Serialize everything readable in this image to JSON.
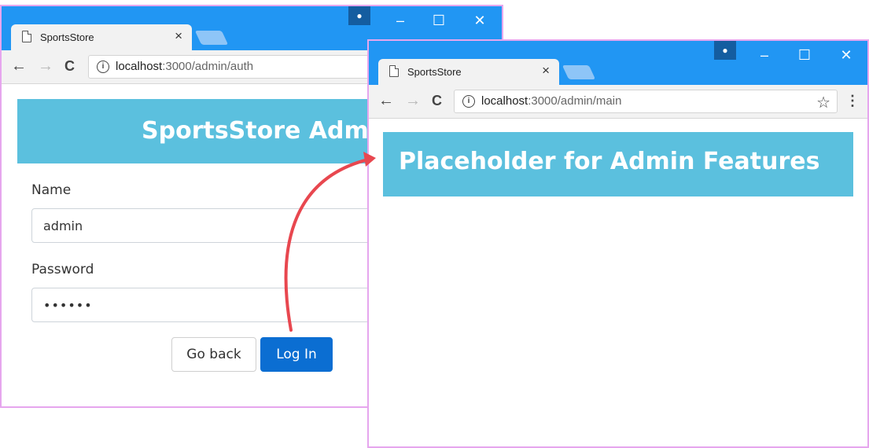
{
  "back_window": {
    "tab_title": "SportsStore",
    "url_host": "localhost",
    "url_path": ":3000/admin/auth",
    "banner_title": "SportsStore Admin",
    "form": {
      "name_label": "Name",
      "name_value": "admin",
      "password_label": "Password",
      "password_value": "••••••"
    },
    "buttons": {
      "go_back": "Go back",
      "log_in": "Log In"
    }
  },
  "front_window": {
    "tab_title": "SportsStore",
    "url_host": "localhost",
    "url_path": ":3000/admin/main",
    "banner_title": "Placeholder for Admin Features"
  },
  "icons": {
    "close_tab": "×",
    "back": "←",
    "forward": "→",
    "reload": "C",
    "info": "i",
    "star": "☆",
    "menu": "⋮",
    "avatar": "👤",
    "minimize": "–",
    "maximize": "☐",
    "close_window": "✕"
  },
  "colors": {
    "title_bar": "#2196f3",
    "banner": "#5bc0de",
    "primary_button": "#0b6ed2",
    "arrow": "#e8474f"
  }
}
